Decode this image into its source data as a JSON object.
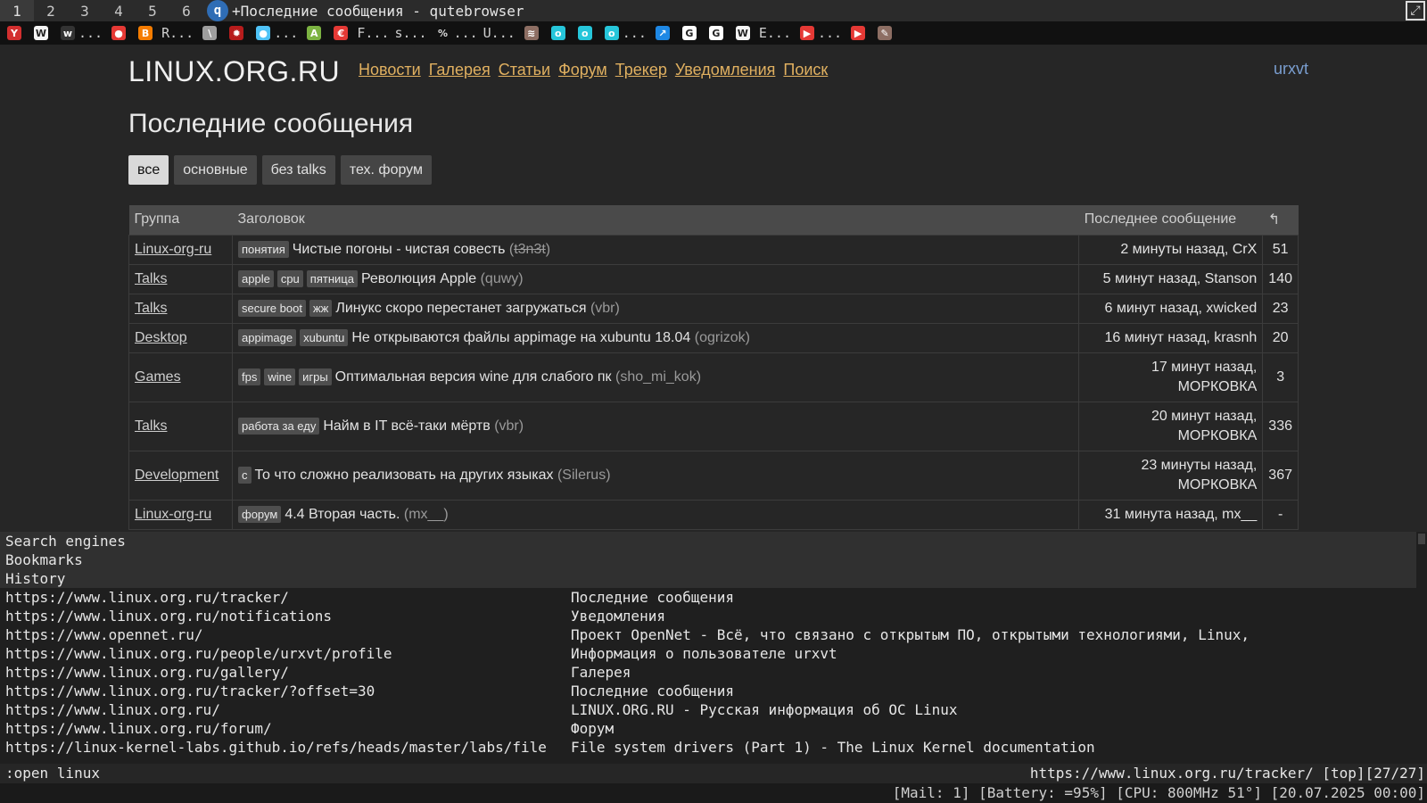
{
  "wm": {
    "workspaces": [
      "1",
      "2",
      "3",
      "4",
      "5",
      "6"
    ],
    "active_workspace": "1",
    "window_title": "+Последние сообщения - qutebrowser"
  },
  "tabs": [
    {
      "icon": "yandex-icon",
      "color": "#d32f2f",
      "glyph": "Y",
      "label": ""
    },
    {
      "icon": "wikipedia-icon",
      "color": "#f5f5f5",
      "glyph": "W",
      "label": ""
    },
    {
      "icon": "wiktionary-icon",
      "color": "#333333",
      "glyph": "w",
      "label": "..."
    },
    {
      "icon": "tomato-icon",
      "color": "#e53935",
      "glyph": "●",
      "label": ""
    },
    {
      "icon": "blogger-icon",
      "color": "#f57c00",
      "glyph": "B",
      "label": ""
    },
    {
      "icon": "",
      "color": "",
      "glyph": "",
      "label": "R..."
    },
    {
      "icon": "doc-icon",
      "color": "#9e9e9e",
      "glyph": "\\",
      "label": ""
    },
    {
      "icon": "gear-red-icon",
      "color": "#b71c1c",
      "glyph": "✹",
      "label": ""
    },
    {
      "icon": "magnifier-icon",
      "color": "#4fc3f7",
      "glyph": "●",
      "label": "..."
    },
    {
      "icon": "android-icon",
      "color": "#7cb342",
      "glyph": "A",
      "label": ""
    },
    {
      "icon": "ruby-icon",
      "color": "#e53935",
      "glyph": "€",
      "label": ""
    },
    {
      "icon": "",
      "color": "",
      "glyph": "",
      "label": "F..."
    },
    {
      "icon": "",
      "color": "",
      "glyph": "",
      "label": "s..."
    },
    {
      "icon": "percent-icon",
      "color": "",
      "glyph": "%",
      "label": "..."
    },
    {
      "icon": "",
      "color": "",
      "glyph": "",
      "label": "U..."
    },
    {
      "icon": "cat-icon",
      "color": "#8d6e63",
      "glyph": "≋",
      "label": ""
    },
    {
      "icon": "ok-icon",
      "color": "#26c6da",
      "glyph": "o",
      "label": ""
    },
    {
      "icon": "ok-icon",
      "color": "#26c6da",
      "glyph": "o",
      "label": ""
    },
    {
      "icon": "ok-icon",
      "color": "#26c6da",
      "glyph": "o",
      "label": "..."
    },
    {
      "icon": "chart-icon",
      "color": "#1e88e5",
      "glyph": "↗",
      "label": ""
    },
    {
      "icon": "google-icon",
      "color": "#ffffff",
      "glyph": "G",
      "label": ""
    },
    {
      "icon": "google-icon",
      "color": "#ffffff",
      "glyph": "G",
      "label": ""
    },
    {
      "icon": "wikipedia-icon",
      "color": "#f5f5f5",
      "glyph": "W",
      "label": ""
    },
    {
      "icon": "",
      "color": "",
      "glyph": "",
      "label": "E..."
    },
    {
      "icon": "youtube-icon",
      "color": "#e53935",
      "glyph": "▶",
      "label": "..."
    },
    {
      "icon": "youtube-icon",
      "color": "#e53935",
      "glyph": "▶",
      "label": ""
    },
    {
      "icon": "pen-icon",
      "color": "#8d6e63",
      "glyph": "✎",
      "label": ""
    }
  ],
  "site": {
    "logo": "LINUX.ORG.RU",
    "nav": [
      "Новости",
      "Галерея",
      "Статьи",
      "Форум",
      "Трекер",
      "Уведомления",
      "Поиск"
    ],
    "user": "urxvt",
    "page_title": "Последние сообщения",
    "filters": [
      {
        "label": "все",
        "active": true
      },
      {
        "label": "основные",
        "active": false
      },
      {
        "label": "без talks",
        "active": false
      },
      {
        "label": "тех. форум",
        "active": false
      }
    ],
    "columns": {
      "group": "Группа",
      "title": "Заголовок",
      "last": "Последнее сообщение",
      "reply_icon": "reply-icon"
    },
    "rows": [
      {
        "group": "Linux-org-ru",
        "tags": [
          "понятия"
        ],
        "title": "Чистые погоны - чистая совесть",
        "author": "t3n3t",
        "author_deleted": true,
        "last": [
          "2 минуты назад, CrX"
        ],
        "count": "51"
      },
      {
        "group": "Talks",
        "tags": [
          "apple",
          "cpu",
          "пятница"
        ],
        "title": "Революция Apple",
        "author": "quwy",
        "author_deleted": false,
        "last": [
          "5 минут назад, Stanson"
        ],
        "count": "140"
      },
      {
        "group": "Talks",
        "tags": [
          "secure boot",
          "жж"
        ],
        "title": "Линукс скоро перестанет загружаться",
        "author": "vbr",
        "author_deleted": false,
        "last": [
          "6 минут назад, xwicked"
        ],
        "count": "23"
      },
      {
        "group": "Desktop",
        "tags": [
          "appimage",
          "xubuntu"
        ],
        "title": "Не открываются файлы appimage на xubuntu 18.04",
        "author": "ogrizok",
        "author_deleted": false,
        "last": [
          "16 минут назад, krasnh"
        ],
        "count": "20"
      },
      {
        "group": "Games",
        "tags": [
          "fps",
          "wine",
          "игры"
        ],
        "title": "Оптимальная версия wine для слабого пк",
        "author": "sho_mi_kok",
        "author_deleted": false,
        "last": [
          "17 минут назад,",
          "МОРКОВКА"
        ],
        "count": "3"
      },
      {
        "group": "Talks",
        "tags": [
          "работа за еду"
        ],
        "title": "Найм в IT всё-таки мёртв",
        "author": "vbr",
        "author_deleted": false,
        "last": [
          "20 минут назад,",
          "МОРКОВКА"
        ],
        "count": "336"
      },
      {
        "group": "Development",
        "tags": [
          "c"
        ],
        "title": "То что сложно реализовать на других языках",
        "author": "Silerus",
        "author_deleted": false,
        "last": [
          "23 минуты назад,",
          "МОРКОВКА"
        ],
        "count": "367"
      },
      {
        "group": "Linux-org-ru",
        "tags": [
          "форум"
        ],
        "title": "4.4 Вторая часть.",
        "author": "mx__",
        "author_deleted": false,
        "last": [
          "31 минута назад, mx__"
        ],
        "count": "-"
      }
    ]
  },
  "completion": {
    "categories": [
      "Search engines",
      "Bookmarks",
      "History"
    ],
    "history": [
      {
        "url": "https://www.linux.org.ru/tracker/",
        "title": "Последние сообщения"
      },
      {
        "url": "https://www.linux.org.ru/notifications",
        "title": "Уведомления"
      },
      {
        "url": "https://www.opennet.ru/",
        "title": "Проект OpenNet - Всё, что связано с открытым ПО, открытыми технологиями, Linux,"
      },
      {
        "url": "https://www.linux.org.ru/people/urxvt/profile",
        "title": "Информация о пользователе urxvt"
      },
      {
        "url": "https://www.linux.org.ru/gallery/",
        "title": "Галерея"
      },
      {
        "url": "https://www.linux.org.ru/tracker/?offset=30",
        "title": "Последние сообщения"
      },
      {
        "url": "https://www.linux.org.ru/",
        "title": "LINUX.ORG.RU - Русская информация об ОС Linux"
      },
      {
        "url": "https://www.linux.org.ru/forum/",
        "title": "Форум"
      },
      {
        "url": "https://linux-kernel-labs.github.io/refs/heads/master/labs/file",
        "title": "File system drivers (Part 1) - The Linux Kernel documentation"
      }
    ]
  },
  "cmdline": {
    "input": ":open linux",
    "status_url": "https://www.linux.org.ru/tracker/",
    "scroll": "[top]",
    "progress": "[27/27]"
  },
  "sysbar": {
    "text": "[Mail: 1] [Battery: =95%] [CPU: 800MHz 51°] [20.07.2025 00:00]"
  }
}
